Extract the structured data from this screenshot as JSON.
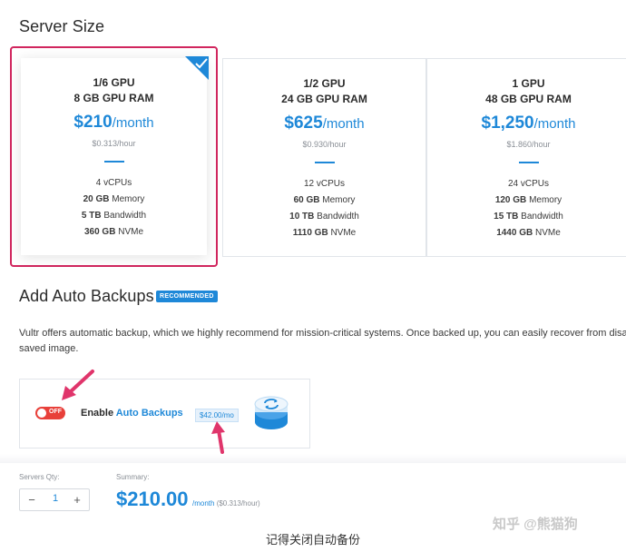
{
  "headings": {
    "server_size": "Server Size",
    "add_backups": "Add Auto Backups",
    "recommended_badge": "RECOMMENDED"
  },
  "plans": [
    {
      "gpu": "1/6 GPU",
      "ram": "8 GB GPU RAM",
      "price": "$210",
      "per": "/month",
      "hourly": "$0.313/hour",
      "vcpus": "4 vCPUs",
      "memory_b": "20 GB",
      "memory_t": "Memory",
      "bw_b": "5 TB",
      "bw_t": "Bandwidth",
      "disk_b": "360 GB",
      "disk_t": "NVMe",
      "selected": true
    },
    {
      "gpu": "1/2 GPU",
      "ram": "24 GB GPU RAM",
      "price": "$625",
      "per": "/month",
      "hourly": "$0.930/hour",
      "vcpus": "12 vCPUs",
      "memory_b": "60 GB",
      "memory_t": "Memory",
      "bw_b": "10 TB",
      "bw_t": "Bandwidth",
      "disk_b": "1110 GB",
      "disk_t": "NVMe",
      "selected": false
    },
    {
      "gpu": "1 GPU",
      "ram": "48 GB GPU RAM",
      "price": "$1,250",
      "per": "/month",
      "hourly": "$1.860/hour",
      "vcpus": "24 vCPUs",
      "memory_b": "120 GB",
      "memory_t": "Memory",
      "bw_b": "15 TB",
      "bw_t": "Bandwidth",
      "disk_b": "1440 GB",
      "disk_t": "NVMe",
      "selected": false
    }
  ],
  "backups": {
    "description_line1": "Vultr offers automatic backup, which we highly recommend for mission-critical systems. Once backed up, you can easily recover from disas",
    "description_line2": "saved image.",
    "toggle_text": "OFF",
    "enable_text": "Enable ",
    "enable_highlight": "Auto Backups",
    "price_tag": "$42.00/mo"
  },
  "footer": {
    "servers_qty_label": "Servers Qty:",
    "summary_label": "Summary:",
    "qty_minus": "−",
    "qty_value": "1",
    "qty_plus": "+",
    "summary_price": "$210.00",
    "summary_per": "/month",
    "summary_hourly": " ($0.313/hour)"
  },
  "caption": "记得关闭自动备份",
  "watermark": "知乎 @熊猫狗",
  "colors": {
    "accent": "#1e88d8",
    "selected_border": "#d1265e",
    "toggle_off": "#e8403a",
    "arrow": "#e0356b"
  }
}
